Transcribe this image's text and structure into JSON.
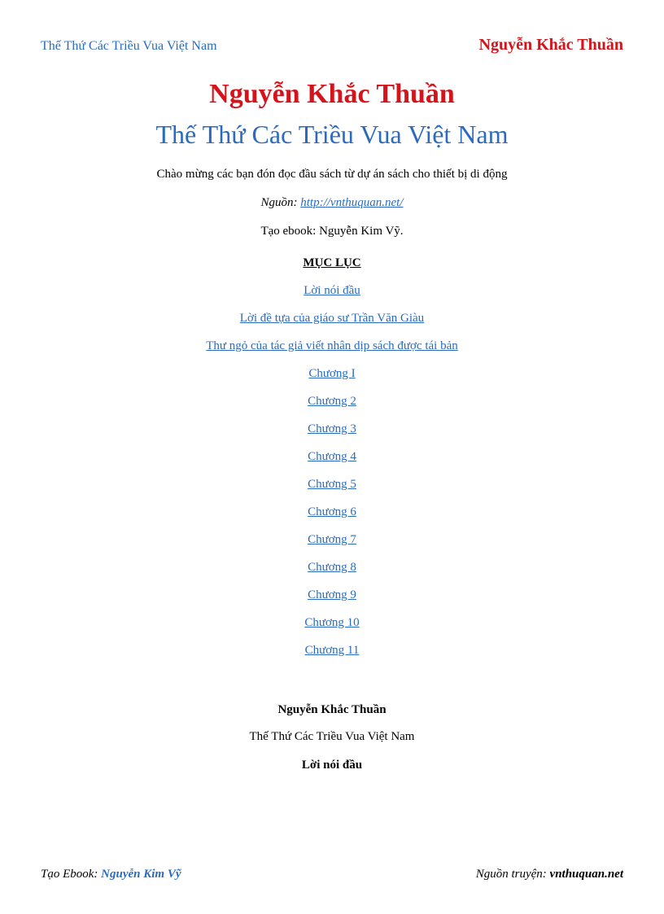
{
  "header": {
    "left": "Thế Thứ Các Triều Vua Việt Nam",
    "right": "Nguyễn Khắc Thuần"
  },
  "title": {
    "author": "Nguyễn Khắc Thuần",
    "book": "Thế Thứ Các Triều Vua Việt Nam"
  },
  "intro": "Chào mừng các bạn đón đọc đầu sách từ dự án sách cho thiết bị di động",
  "source_label": "Nguồn: ",
  "source_url": "http://vnthuquan.net/",
  "creator": "Tạo ebook: Nguyễn Kim Vỹ.",
  "toc_header": "MỤC LỤC",
  "toc": [
    "Lời nói đầu",
    "Lời đề tựa của giáo sư Trần Văn Giàu",
    "Thư ngỏ của tác giả viết nhân dịp sách được tái bản",
    "Chương I",
    "Chương 2",
    "Chương 3",
    "Chương 4",
    "Chương 5",
    "Chương 6",
    "Chương 7",
    "Chương 8",
    "Chương 9",
    "Chương 10",
    "Chương 11"
  ],
  "repeat": {
    "author": "Nguyễn Khắc Thuần",
    "book": "Thế Thứ Các Triều Vua Việt Nam",
    "section": "Lời nói đầu"
  },
  "footer": {
    "left_label": "Tạo Ebook",
    "left_value": "Nguyễn Kim Vỹ",
    "right_label": "Nguồn truyện",
    "right_value": "vnthuquan.net"
  }
}
